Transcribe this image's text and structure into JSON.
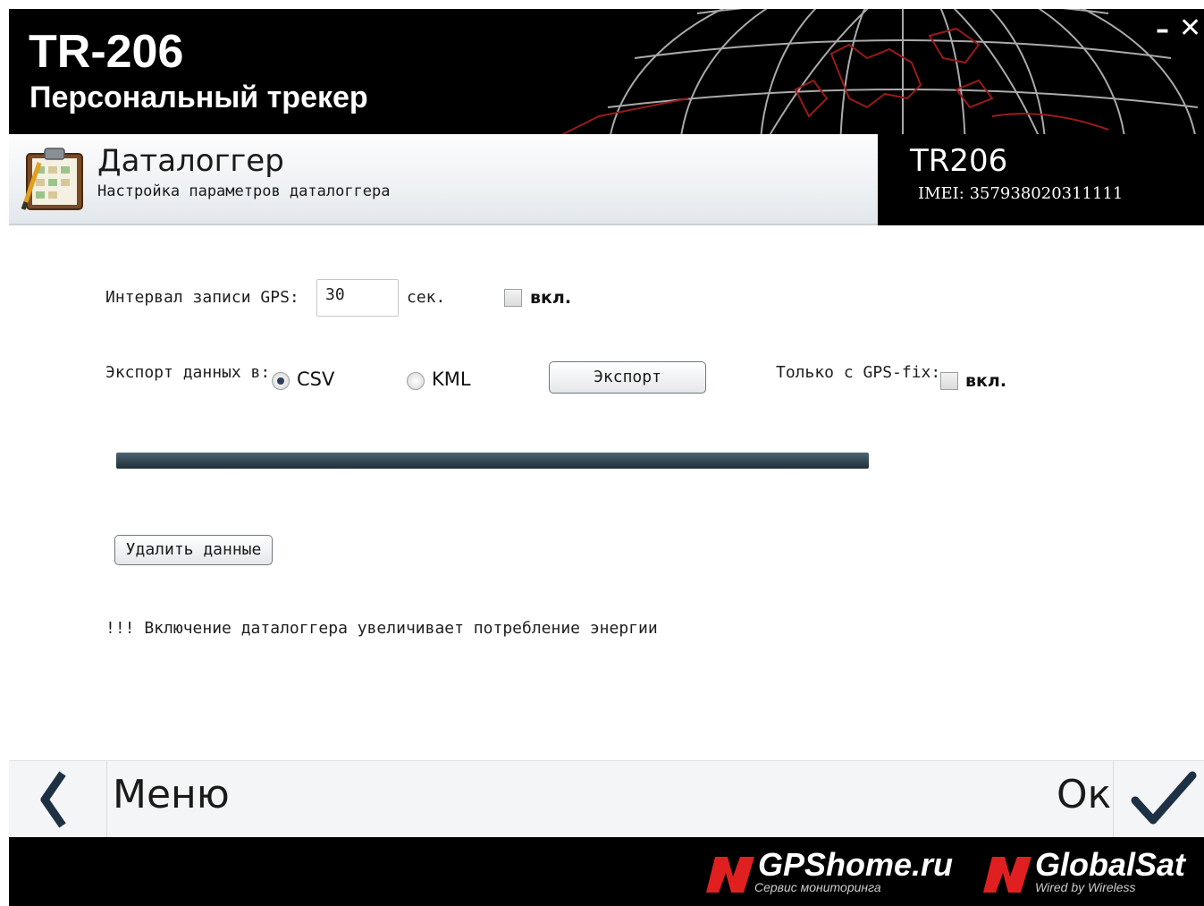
{
  "header": {
    "title": "TR-206",
    "subtitle": "Персональный трекер",
    "minimize_label": "–",
    "close_label": "✕"
  },
  "section": {
    "title": "Даталоггер",
    "subtitle": "Настройка параметров даталоггера",
    "icon": "clipboard-icon"
  },
  "device": {
    "model": "TR206",
    "imei": "IMEI: 357938020311111"
  },
  "form": {
    "interval_label": "Интервал записи GPS:",
    "interval_value": "30",
    "interval_unit": "сек.",
    "interval_enable_label": "вкл.",
    "interval_enabled": false,
    "export_label": "Экспорт данных в:",
    "export_options": [
      {
        "label": "CSV",
        "checked": true
      },
      {
        "label": "KML",
        "checked": false
      }
    ],
    "export_button": "Экспорт",
    "gps_fix_label": "Только с GPS-fix:",
    "gps_fix_enable_label": "вкл.",
    "gps_fix_enabled": false,
    "progress_fraction": 1.0,
    "delete_button": "Удалить данные",
    "warning": "!!! Включение даталоггера увеличивает потребление энергии"
  },
  "nav": {
    "back_label": "Меню",
    "ok_label": "Ок"
  },
  "brands": {
    "gpshome_name": "GPShome.ru",
    "gpshome_tagline": "Сервис мониторинга",
    "globalsat_name": "GlobalSat",
    "globalsat_tagline": "Wired by Wireless",
    "logo_color": "#e02020"
  }
}
